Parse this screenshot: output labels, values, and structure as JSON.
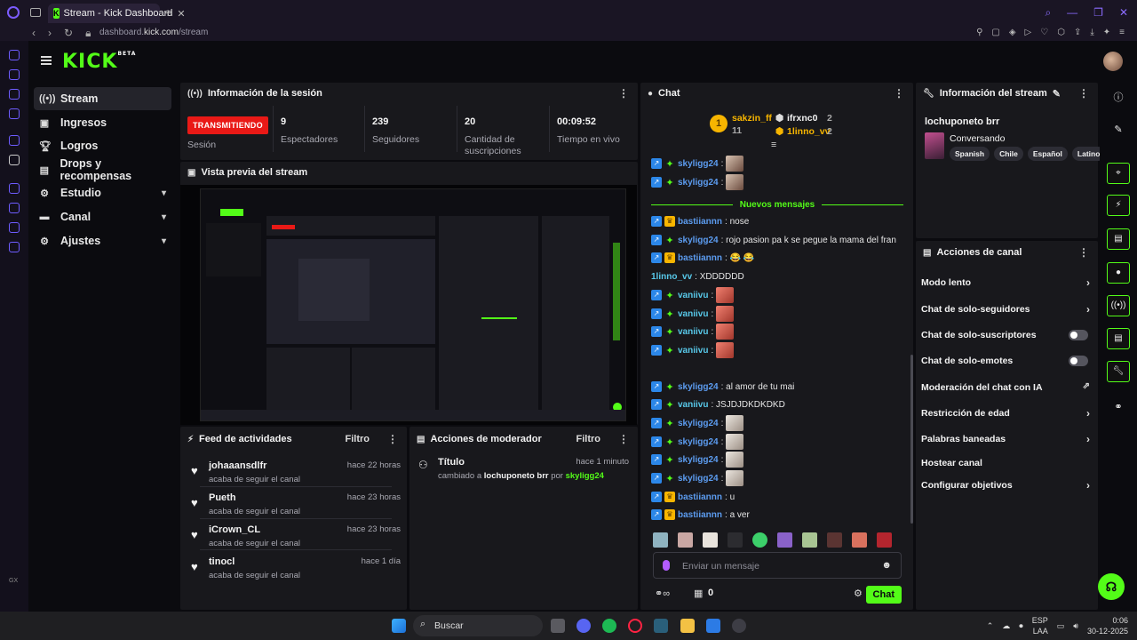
{
  "browser": {
    "tab_title": "Stream - Kick Dashboard",
    "tab_favicon": "K",
    "url_prefix": "dashboard.",
    "url_domain": "kick.com",
    "url_path": "/stream",
    "new_tab": "+",
    "gx_label": "GX"
  },
  "header": {
    "logo": "KICK",
    "logo_badge": "BETA"
  },
  "nav": {
    "items": [
      {
        "label": "Stream",
        "icon": "stream-icon"
      },
      {
        "label": "Ingresos",
        "icon": "wallet-icon"
      },
      {
        "label": "Logros",
        "icon": "trophy-icon"
      },
      {
        "label": "Drops y recompensas",
        "icon": "gift-icon"
      },
      {
        "label": "Estudio",
        "icon": "gear-icon"
      },
      {
        "label": "Canal",
        "icon": "user-icon"
      },
      {
        "label": "Ajustes",
        "icon": "settings-icon"
      }
    ]
  },
  "session": {
    "title": "Información de la sesión",
    "live": "TRANSMITIENDO",
    "live_label": "Sesión",
    "stats": [
      {
        "value": "9",
        "label": "Espectadores"
      },
      {
        "value": "239",
        "label": "Seguidores"
      },
      {
        "value": "20",
        "label": "Cantidad de suscripciones"
      },
      {
        "value": "00:09:52",
        "label": "Tiempo en vivo"
      }
    ]
  },
  "preview": {
    "title": "Vista previa del stream"
  },
  "feed": {
    "title": "Feed de actividades",
    "filter": "Filtro",
    "items": [
      {
        "name": "johaaansdlfr",
        "action": "acaba de seguir el canal",
        "time": "hace 22 horas"
      },
      {
        "name": "Pueth",
        "action": "acaba de seguir el canal",
        "time": "hace 23 horas"
      },
      {
        "name": "iCrown_CL",
        "action": "acaba de seguir el canal",
        "time": "hace 23 horas"
      },
      {
        "name": "tinocl",
        "action": "acaba de seguir el canal",
        "time": "hace 1 día"
      }
    ]
  },
  "mod_actions": {
    "title": "Acciones de moderador",
    "filter": "Filtro",
    "item_title": "Título",
    "item_time": "hace 1 minuto",
    "item_prefix": "cambiado a",
    "item_value": "lochuponeto brr",
    "item_by": "por",
    "item_user": "skyligg24"
  },
  "chat": {
    "title": "Chat",
    "top": [
      {
        "name": "sakzin_ff",
        "count": "11",
        "rank": "1"
      },
      {
        "name": "ifrxnc0",
        "count": "2"
      },
      {
        "name": "1linno_vv",
        "count": "2"
      }
    ],
    "new_messages": "Nuevos mensajes",
    "messages": [
      {
        "user": "skyligg24",
        "text": ":",
        "emote": "a",
        "type": "mod"
      },
      {
        "user": "skyligg24",
        "text": ":",
        "emote": "a",
        "type": "mod"
      },
      {
        "user": "bastiiannn",
        "text": ": nose",
        "emote": "",
        "type": "crown"
      },
      {
        "user": "skyligg24",
        "text": ": rojo pasion pa k se pegue la mama del fran",
        "emote": "",
        "type": "mod"
      },
      {
        "user": "bastiiannn",
        "text": ": 😂 😂",
        "emote": "",
        "type": "crown"
      },
      {
        "user": "1linno_vv",
        "text": ": XDDDDDD",
        "emote": "",
        "type": "plain"
      },
      {
        "user": "vaniivu",
        "text": ":",
        "emote": "b",
        "type": "mod"
      },
      {
        "user": "vaniivu",
        "text": ":",
        "emote": "b",
        "type": "mod"
      },
      {
        "user": "vaniivu",
        "text": ":",
        "emote": "b",
        "type": "mod"
      },
      {
        "user": "vaniivu",
        "text": ":",
        "emote": "b",
        "type": "mod"
      },
      {
        "user": "skyligg24",
        "text": ": al amor de tu mai",
        "emote": "",
        "type": "mod"
      },
      {
        "user": "vaniivu",
        "text": ": JSJDJDKDKDKD",
        "emote": "",
        "type": "mod"
      },
      {
        "user": "skyligg24",
        "text": ":",
        "emote": "c",
        "type": "mod"
      },
      {
        "user": "skyligg24",
        "text": ":",
        "emote": "c",
        "type": "mod"
      },
      {
        "user": "skyligg24",
        "text": ":",
        "emote": "c",
        "type": "mod"
      },
      {
        "user": "skyligg24",
        "text": ":",
        "emote": "c",
        "type": "mod"
      },
      {
        "user": "bastiiannn",
        "text": ": u",
        "emote": "",
        "type": "crown"
      },
      {
        "user": "bastiiannn",
        "text": ": a ver",
        "emote": "",
        "type": "crown"
      }
    ],
    "input_placeholder": "Enviar un mensaje",
    "points": "0",
    "send_button": "Chat"
  },
  "stream_info": {
    "title": "Información del stream",
    "stream_title": "lochuponeto brr",
    "category": "Conversando",
    "tags": [
      "Spanish",
      "Chile",
      "Español",
      "Latino"
    ]
  },
  "channel_actions": {
    "title": "Acciones de canal",
    "items": [
      {
        "label": "Modo lento",
        "control": "chevron"
      },
      {
        "label": "Chat de solo-seguidores",
        "control": "chevron"
      },
      {
        "label": "Chat de solo-suscriptores",
        "control": "toggle"
      },
      {
        "label": "Chat de solo-emotes",
        "control": "toggle"
      },
      {
        "label": "Moderación del chat con IA",
        "control": "external"
      },
      {
        "label": "Restricción de edad",
        "control": "chevron"
      },
      {
        "label": "Palabras baneadas",
        "control": "chevron"
      },
      {
        "label": "Hostear canal",
        "control": "none"
      },
      {
        "label": "Configurar objetivos",
        "control": "chevron"
      }
    ]
  },
  "taskbar": {
    "search": "Buscar",
    "lang": "ESP",
    "layout": "LAA",
    "time": "0:06",
    "date": "30-12-2025"
  },
  "colors": {
    "accent": "#53fc18",
    "live": "#e91916",
    "panel": "#18181c",
    "bg": "#0b0b0f"
  }
}
